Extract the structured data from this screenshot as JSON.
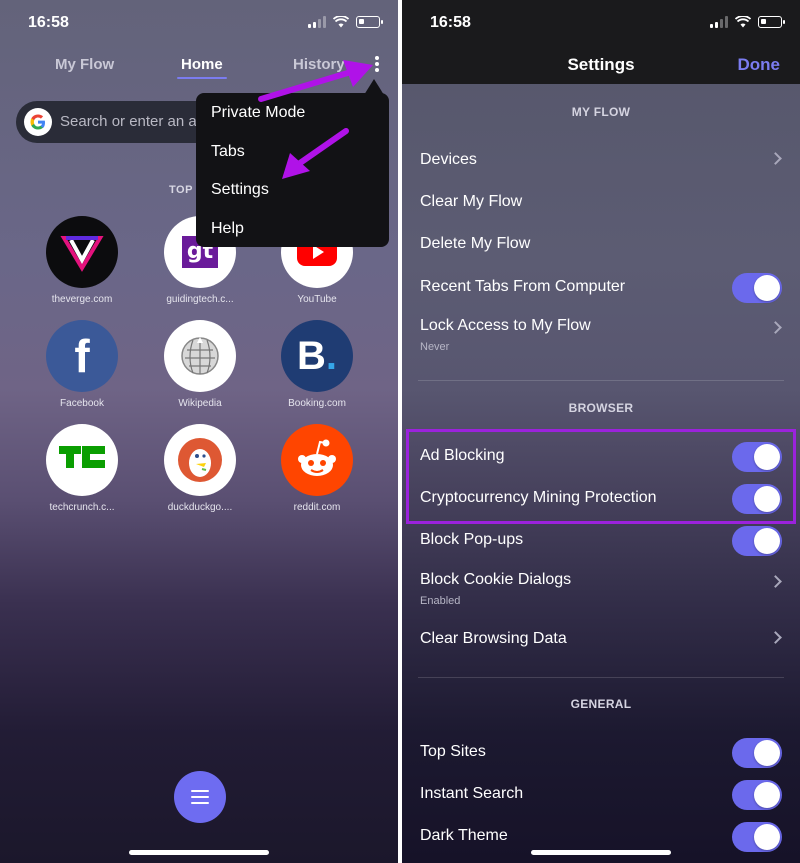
{
  "left_screen": {
    "status": {
      "time": "16:58"
    },
    "tabs": [
      {
        "label": "My Flow"
      },
      {
        "label": "Home"
      },
      {
        "label": "History"
      }
    ],
    "search": {
      "placeholder": "Search or enter an a"
    },
    "top_sites_label": "TOP",
    "top_sites": [
      {
        "label": "theverge.com",
        "icon": "verge-logo"
      },
      {
        "label": "guidingtech.c...",
        "icon": "guidingtech-logo"
      },
      {
        "label": "YouTube",
        "icon": "youtube-logo"
      },
      {
        "label": "Facebook",
        "icon": "facebook-logo"
      },
      {
        "label": "Wikipedia",
        "icon": "wikipedia-logo"
      },
      {
        "label": "Booking.com",
        "icon": "booking-logo"
      },
      {
        "label": "techcrunch.c...",
        "icon": "techcrunch-logo"
      },
      {
        "label": "duckduckgo....",
        "icon": "duckduckgo-logo"
      },
      {
        "label": "reddit.com",
        "icon": "reddit-logo"
      }
    ],
    "menu": [
      {
        "label": "Private Mode"
      },
      {
        "label": "Tabs"
      },
      {
        "label": "Settings"
      },
      {
        "label": "Help"
      }
    ]
  },
  "right_screen": {
    "status": {
      "time": "16:58"
    },
    "header": {
      "title": "Settings",
      "done": "Done"
    },
    "sections": {
      "my_flow": {
        "title": "MY FLOW",
        "rows": [
          {
            "label": "Devices"
          },
          {
            "label": "Clear My Flow"
          },
          {
            "label": "Delete My Flow"
          },
          {
            "label": "Recent Tabs From Computer",
            "toggle_on": true
          },
          {
            "label": "Lock Access to My Flow",
            "subtitle": "Never"
          }
        ]
      },
      "browser": {
        "title": "BROWSER",
        "rows": [
          {
            "label": "Ad Blocking",
            "toggle_on": true
          },
          {
            "label": "Cryptocurrency Mining Protection",
            "toggle_on": true
          },
          {
            "label": "Block Pop-ups",
            "toggle_on": true
          },
          {
            "label": "Block Cookie Dialogs",
            "subtitle": "Enabled"
          },
          {
            "label": "Clear Browsing Data"
          }
        ]
      },
      "general": {
        "title": "GENERAL",
        "rows": [
          {
            "label": "Top Sites",
            "toggle_on": true
          },
          {
            "label": "Instant Search",
            "toggle_on": true
          },
          {
            "label": "Dark Theme",
            "toggle_on": true
          }
        ]
      }
    }
  },
  "colors": {
    "accent": "#6b69ec",
    "annotation": "#9b22dc",
    "header_bg": "#1a1a1c"
  }
}
